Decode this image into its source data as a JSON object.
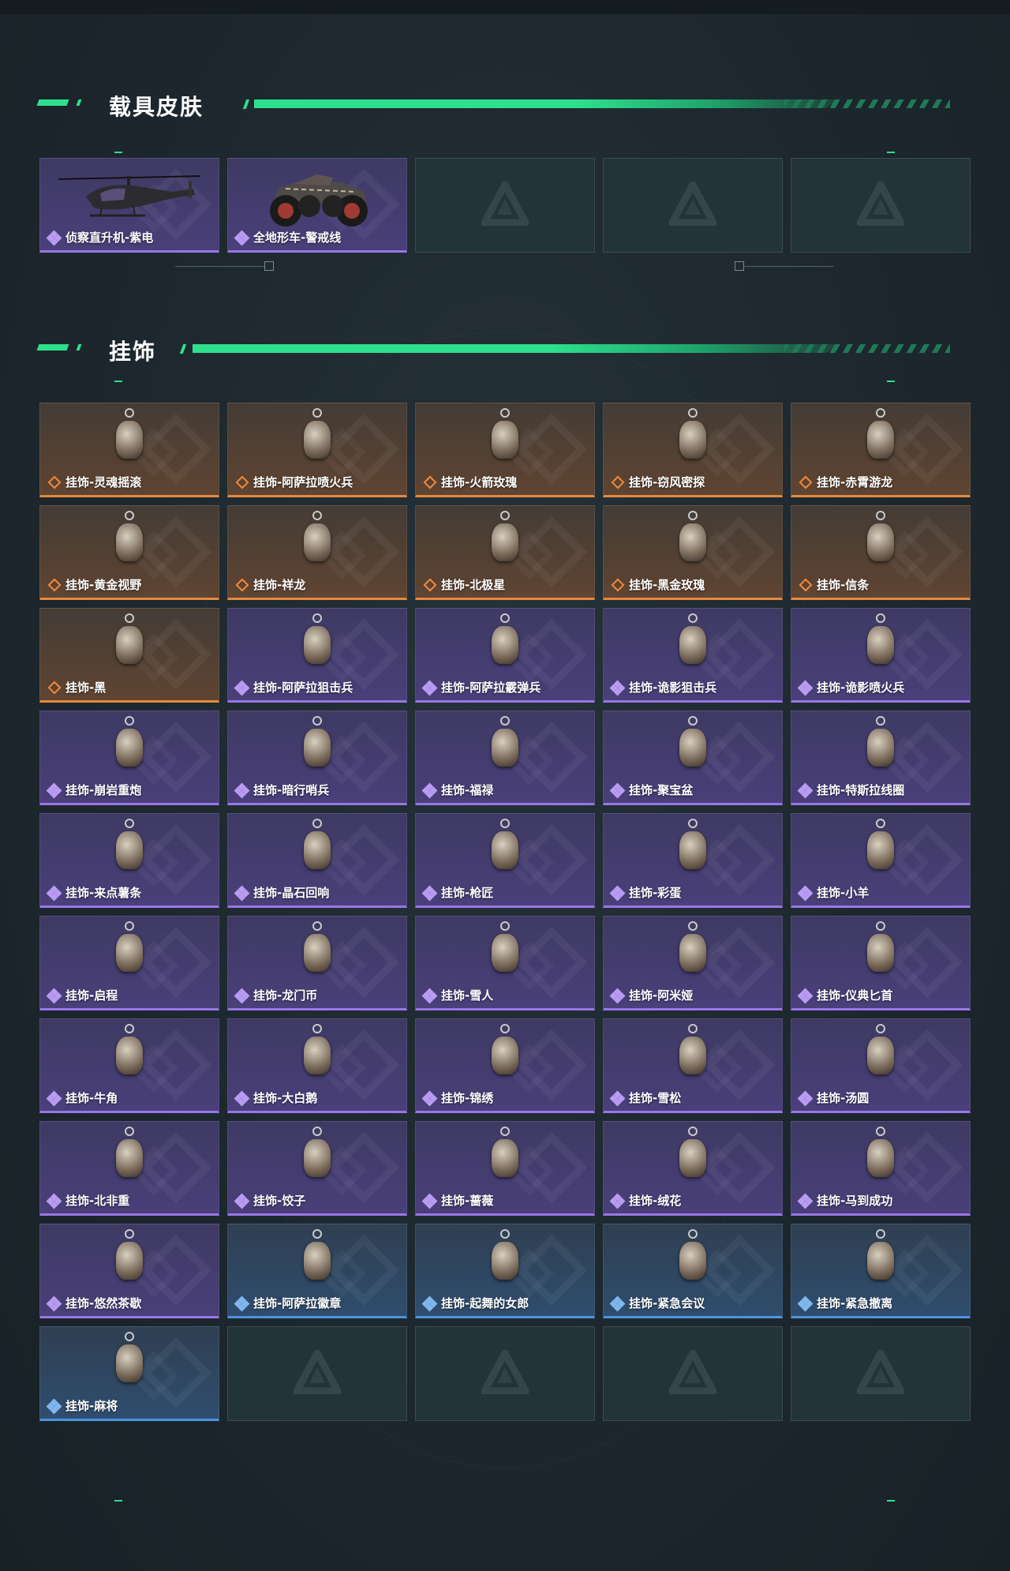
{
  "sections": {
    "vehicles": {
      "title": "载具皮肤",
      "items": [
        {
          "label": "侦察直升机-紫电",
          "rarity": "purple",
          "icon": "helicopter-icon"
        },
        {
          "label": "全地形车-警戒线",
          "rarity": "purple",
          "icon": "atv-icon"
        }
      ]
    },
    "charms": {
      "title": "挂饰",
      "items": [
        {
          "label": "挂饰-灵魂摇滚",
          "rarity": "orange"
        },
        {
          "label": "挂饰-阿萨拉喷火兵",
          "rarity": "orange"
        },
        {
          "label": "挂饰-火箭玫瑰",
          "rarity": "orange"
        },
        {
          "label": "挂饰-窃风密探",
          "rarity": "orange"
        },
        {
          "label": "挂饰-赤霄游龙",
          "rarity": "orange"
        },
        {
          "label": "挂饰-黄金视野",
          "rarity": "orange"
        },
        {
          "label": "挂饰-祥龙",
          "rarity": "orange"
        },
        {
          "label": "挂饰-北极星",
          "rarity": "orange"
        },
        {
          "label": "挂饰-黑金玫瑰",
          "rarity": "orange"
        },
        {
          "label": "挂饰-信条",
          "rarity": "orange"
        },
        {
          "label": "挂饰-黑",
          "rarity": "orange"
        },
        {
          "label": "挂饰-阿萨拉狙击兵",
          "rarity": "purple"
        },
        {
          "label": "挂饰-阿萨拉霰弹兵",
          "rarity": "purple"
        },
        {
          "label": "挂饰-诡影狙击兵",
          "rarity": "purple"
        },
        {
          "label": "挂饰-诡影喷火兵",
          "rarity": "purple"
        },
        {
          "label": "挂饰-崩岩重炮",
          "rarity": "purple"
        },
        {
          "label": "挂饰-暗行哨兵",
          "rarity": "purple"
        },
        {
          "label": "挂饰-福禄",
          "rarity": "purple"
        },
        {
          "label": "挂饰-聚宝盆",
          "rarity": "purple"
        },
        {
          "label": "挂饰-特斯拉线圈",
          "rarity": "purple"
        },
        {
          "label": "挂饰-来点薯条",
          "rarity": "purple"
        },
        {
          "label": "挂饰-晶石回响",
          "rarity": "purple"
        },
        {
          "label": "挂饰-枪匠",
          "rarity": "purple"
        },
        {
          "label": "挂饰-彩蛋",
          "rarity": "purple"
        },
        {
          "label": "挂饰-小羊",
          "rarity": "purple"
        },
        {
          "label": "挂饰-启程",
          "rarity": "purple"
        },
        {
          "label": "挂饰-龙门币",
          "rarity": "purple"
        },
        {
          "label": "挂饰-雪人",
          "rarity": "purple"
        },
        {
          "label": "挂饰-阿米娅",
          "rarity": "purple"
        },
        {
          "label": "挂饰-仪典匕首",
          "rarity": "purple"
        },
        {
          "label": "挂饰-牛角",
          "rarity": "purple"
        },
        {
          "label": "挂饰-大白鹅",
          "rarity": "purple"
        },
        {
          "label": "挂饰-锦绣",
          "rarity": "purple"
        },
        {
          "label": "挂饰-雪松",
          "rarity": "purple"
        },
        {
          "label": "挂饰-汤圆",
          "rarity": "purple"
        },
        {
          "label": "挂饰-北非重",
          "rarity": "purple"
        },
        {
          "label": "挂饰-饺子",
          "rarity": "purple"
        },
        {
          "label": "挂饰-蔷薇",
          "rarity": "purple"
        },
        {
          "label": "挂饰-绒花",
          "rarity": "purple"
        },
        {
          "label": "挂饰-马到成功",
          "rarity": "purple"
        },
        {
          "label": "挂饰-悠然茶歇",
          "rarity": "purple"
        },
        {
          "label": "挂饰-阿萨拉徽章",
          "rarity": "blue"
        },
        {
          "label": "挂饰-起舞的女郎",
          "rarity": "blue"
        },
        {
          "label": "挂饰-紧急会议",
          "rarity": "blue"
        },
        {
          "label": "挂饰-紧急撤离",
          "rarity": "blue"
        },
        {
          "label": "挂饰-麻将",
          "rarity": "blue"
        }
      ]
    }
  },
  "colors": {
    "accent": "#2ee08d",
    "purple": "#9a76e8",
    "orange": "#e58a3c",
    "blue": "#4d94e0"
  }
}
